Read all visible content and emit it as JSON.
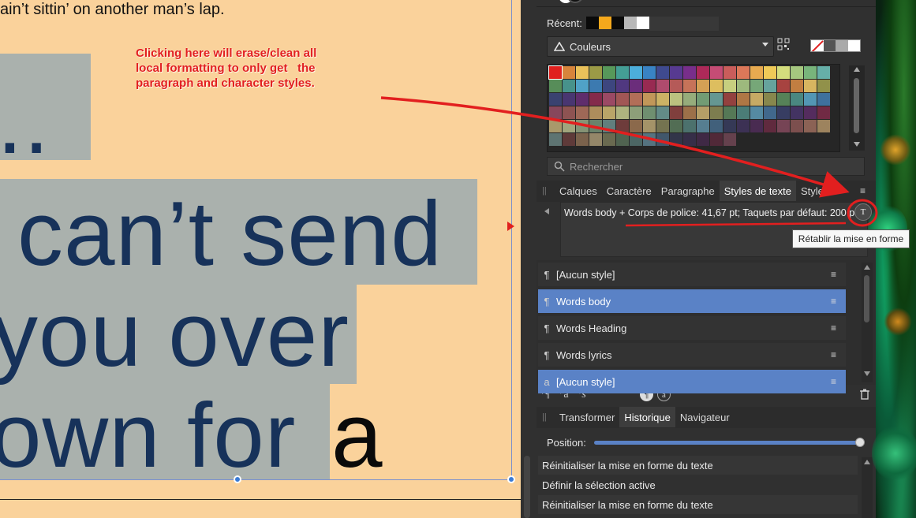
{
  "canvas": {
    "top_text": "ain’t sittin’ on another man’s lap.",
    "dots": "..",
    "line1": "can’t send",
    "line2": "you over",
    "line3a": "own for",
    "line3b": "a",
    "annotation": "Clicking here will erase/clean all\nlocal formatting to only get   the\nparagraph and character styles."
  },
  "panel": {
    "recent_label": "Récent:",
    "recent_swatches": [
      "#0a0a0a",
      "#f5a81c",
      "#0a0a0a",
      "#b8b8b8",
      "#ffffff"
    ],
    "palette_name": "Couleurs",
    "search_placeholder": "Rechercher",
    "colors": {
      "accent": "#5a82c6",
      "annotation_red": "#e21f1f",
      "text_blue": "#17325a"
    },
    "tabs1": [
      {
        "label": "Calques"
      },
      {
        "label": "Caractère"
      },
      {
        "label": "Paragraphe"
      },
      {
        "label": "Styles de texte",
        "active": true
      },
      {
        "label": "Styles"
      }
    ],
    "style_description": "Words body + Corps de police: 41,67 pt; Taquets par défaut: 200 pt",
    "tooltip": "Rétablir la mise en forme",
    "styles": [
      {
        "label": "[Aucun style]",
        "selected": false,
        "icon": "¶"
      },
      {
        "label": "Words body",
        "selected": true,
        "icon": "¶"
      },
      {
        "label": "Words Heading",
        "selected": false,
        "icon": "¶"
      },
      {
        "label": "Words lyrics",
        "selected": false,
        "icon": "¶"
      },
      {
        "label": "[Aucun style]",
        "selected": true,
        "icon": "a"
      }
    ],
    "tabs2": [
      {
        "label": "Transformer"
      },
      {
        "label": "Historique",
        "active": true
      },
      {
        "label": "Navigateur"
      }
    ],
    "position_label": "Position:",
    "position_value": 1.0,
    "history": [
      {
        "label": "Réinitialiser la mise en forme du texte"
      },
      {
        "label": "Définir la sélection active"
      },
      {
        "label": "Réinitialiser la mise en forme du texte"
      }
    ]
  },
  "icons": [
    "swatch-menu-icon",
    "search-icon",
    "panel-menu-icon",
    "reset-formatting-icon",
    "paragraph-icon",
    "character-style-icon",
    "new-paragraph-style-icon",
    "new-character-style-icon",
    "new-group-style-icon",
    "trash-icon",
    "grip-icon",
    "collapse-arrow-icon"
  ]
}
